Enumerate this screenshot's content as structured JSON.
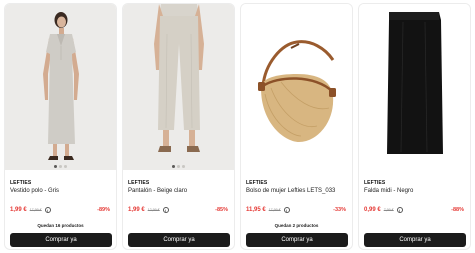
{
  "products": [
    {
      "brand": "LEFTIES",
      "name": "Vestido polo - Gris",
      "price": "1,99 €",
      "old_price": "17,99 €",
      "discount": "-89%",
      "stock": "Quedan 16 productos",
      "button": "Comprar ya",
      "image": "model-wearing-grey-knit-polo-dress",
      "image_dots": 3,
      "active_dot": 1
    },
    {
      "brand": "LEFTIES",
      "name": "Pantalón - Beige claro",
      "price": "1,99 €",
      "old_price": "12,99 €",
      "discount": "-85%",
      "stock": "",
      "button": "Comprar ya",
      "image": "model-wearing-beige-knit-trousers",
      "image_dots": 3,
      "active_dot": 1
    },
    {
      "brand": "LEFTIES",
      "name": "Bolso de mujer Lefties LETS_033",
      "price": "11,95 €",
      "old_price": "17,99 €",
      "discount": "-33%",
      "stock": "Quedan 2 productos",
      "button": "Comprar ya",
      "image": "raffia-half-moon-bag-with-brown-strap"
    },
    {
      "brand": "LEFTIES",
      "name": "Falda midi - Negro",
      "price": "0,99 €",
      "old_price": "7,99 €",
      "discount": "-88%",
      "stock": "",
      "button": "Comprar ya",
      "image": "black-midi-skirt"
    }
  ],
  "info_icon": "i",
  "colors": {
    "price": "#e53935",
    "button_bg": "#1b1b1b",
    "button_text": "#ffffff"
  }
}
